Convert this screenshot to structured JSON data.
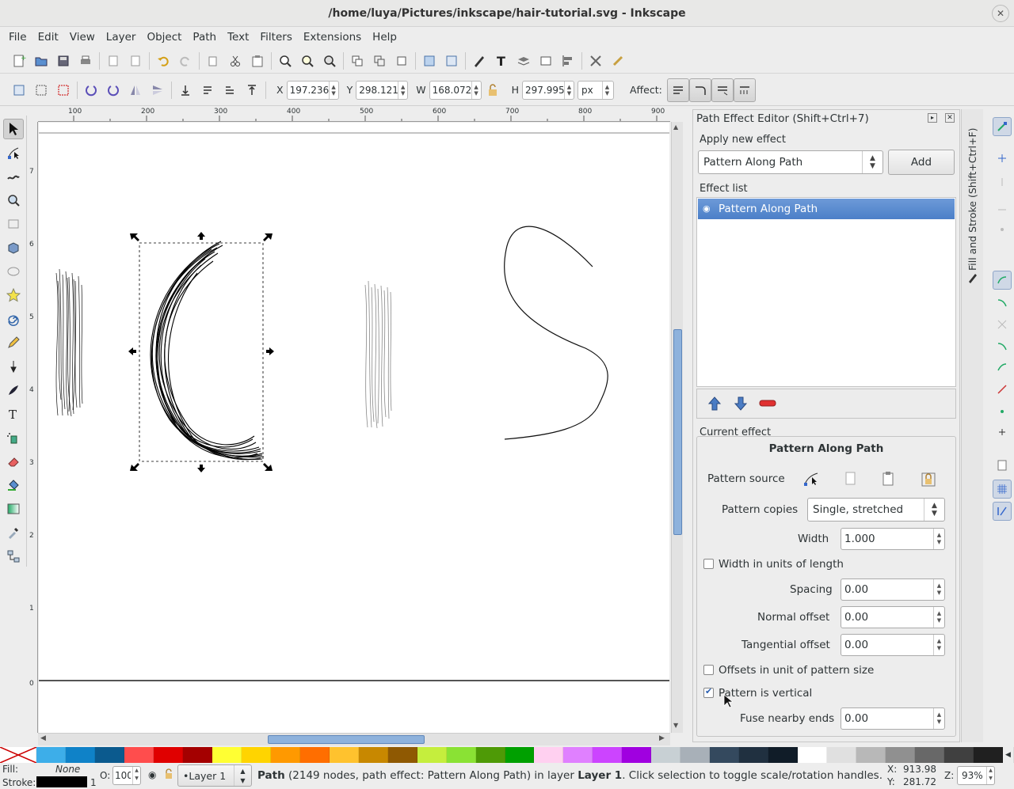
{
  "window": {
    "title": "/home/luya/Pictures/inkscape/hair-tutorial.svg - Inkscape"
  },
  "menu": [
    "File",
    "Edit",
    "View",
    "Layer",
    "Object",
    "Path",
    "Text",
    "Filters",
    "Extensions",
    "Help"
  ],
  "controls": {
    "x_label": "X",
    "x_value": "197.236",
    "y_label": "Y",
    "y_value": "298.121",
    "w_label": "W",
    "w_value": "168.072",
    "h_label": "H",
    "h_value": "297.995",
    "unit": "px",
    "affect_label": "Affect:"
  },
  "ruler": {
    "h_ticks": [
      "100",
      "200",
      "300",
      "400",
      "500",
      "600",
      "700",
      "800",
      "900"
    ],
    "v_ticks": [
      "7",
      "6",
      "5",
      "4",
      "3",
      "2",
      "1",
      "0"
    ]
  },
  "panel": {
    "title": "Path Effect Editor (Shift+Ctrl+7)",
    "apply_group": "Apply new effect",
    "apply_combo": "Pattern Along Path",
    "add_button": "Add",
    "effect_list_label": "Effect list",
    "effect_list": [
      "Pattern Along Path"
    ],
    "current_group": "Current effect",
    "current_name": "Pattern Along Path",
    "pattern_source_label": "Pattern source",
    "pattern_copies_label": "Pattern copies",
    "pattern_copies_value": "Single, stretched",
    "width_label": "Width",
    "width_value": "1.000",
    "width_units_label": "Width in units of length",
    "width_units_checked": false,
    "spacing_label": "Spacing",
    "spacing_value": "0.00",
    "normal_offset_label": "Normal offset",
    "normal_offset_value": "0.00",
    "tangential_offset_label": "Tangential offset",
    "tangential_offset_value": "0.00",
    "offsets_unit_label": "Offsets in unit of pattern size",
    "offsets_unit_checked": false,
    "pattern_vertical_label": "Pattern is vertical",
    "pattern_vertical_checked": true,
    "fuse_label": "Fuse nearby ends",
    "fuse_value": "0.00"
  },
  "dock": {
    "tab_label": "Fill and Stroke (Shift+Ctrl+F)"
  },
  "palette": [
    "#ffffff",
    "#3daee9",
    "#0f82c8",
    "#0b5a8e",
    "#ff4d4d",
    "#e00000",
    "#a40000",
    "#ffff33",
    "#ffd400",
    "#ff9900",
    "#ff6e00",
    "#ffc22e",
    "#c88800",
    "#8f5902",
    "#c5ee3d",
    "#8ae234",
    "#4e9a06",
    "#00a000",
    "#ffd0f0",
    "#e080ff",
    "#cc44ff",
    "#a000e0",
    "#c8d0d4",
    "#a8b0b8",
    "#34495e",
    "#203040",
    "#101c28",
    "#ffffff",
    "#e0e0e0",
    "#b8b8b8",
    "#909090",
    "#686868",
    "#404040",
    "#202020"
  ],
  "status": {
    "fill_label": "Fill:",
    "fill_value": "None",
    "stroke_label": "Stroke:",
    "stroke_width": "1",
    "opacity_label": "O:",
    "opacity_value": "100",
    "layer": "•Layer 1",
    "message_bold": "Path",
    "message": " (2149 nodes, path effect: Pattern Along Path) in layer ",
    "message_layer": "Layer 1",
    "message_tail": ". Click selection to toggle scale/rotation handles.",
    "cx_label": "X:",
    "cx": "913.98",
    "cy_label": "Y:",
    "cy": "281.72",
    "zoom_label": "Z:",
    "zoom": "93%"
  }
}
